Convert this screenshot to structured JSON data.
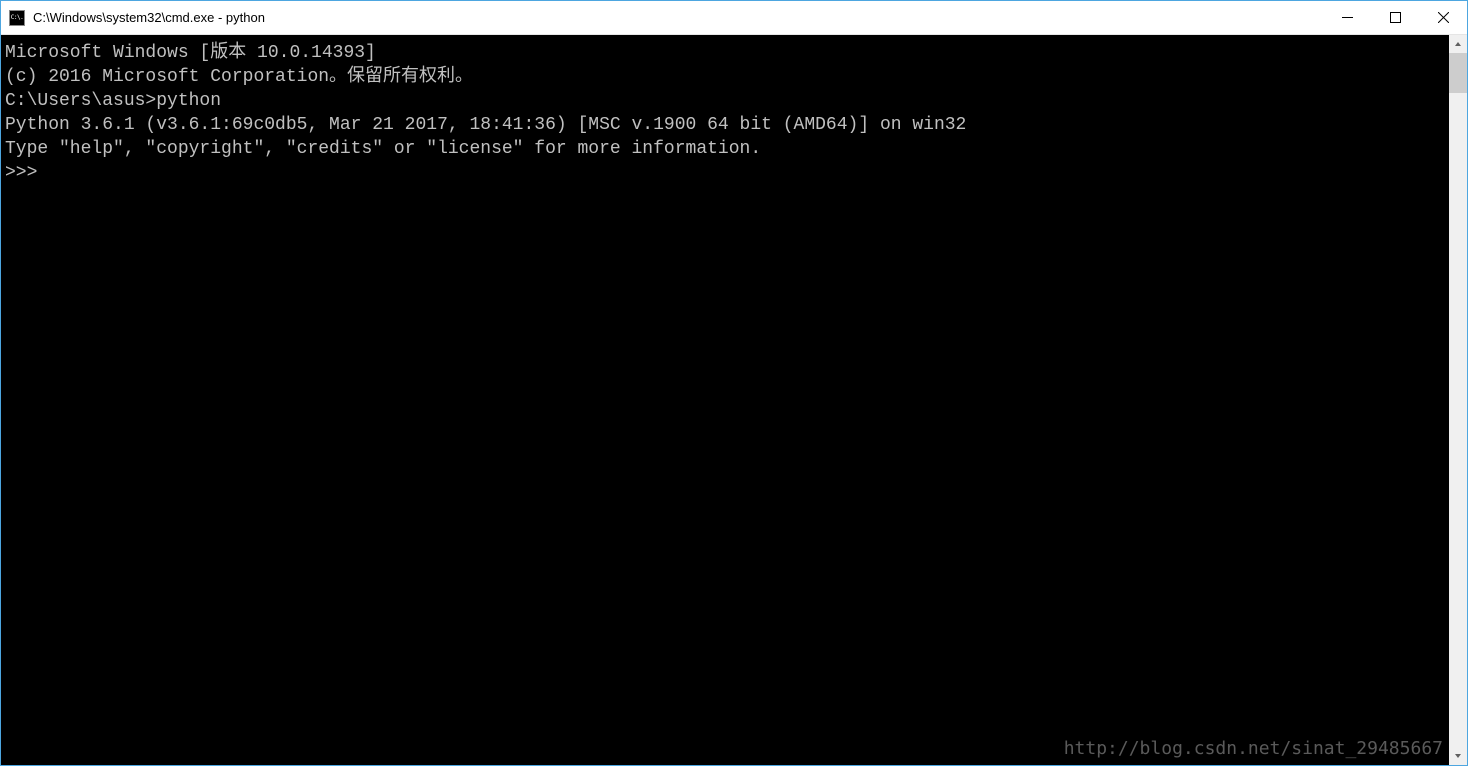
{
  "window": {
    "title": "C:\\Windows\\system32\\cmd.exe - python",
    "icon_label": "C:\\."
  },
  "terminal": {
    "lines": [
      "Microsoft Windows [版本 10.0.14393]",
      "(c) 2016 Microsoft Corporation。保留所有权利。",
      "",
      "C:\\Users\\asus>python",
      "Python 3.6.1 (v3.6.1:69c0db5, Mar 21 2017, 18:41:36) [MSC v.1900 64 bit (AMD64)] on win32",
      "Type \"help\", \"copyright\", \"credits\" or \"license\" for more information.",
      ">>>"
    ]
  },
  "watermark": "http://blog.csdn.net/sinat_29485667"
}
